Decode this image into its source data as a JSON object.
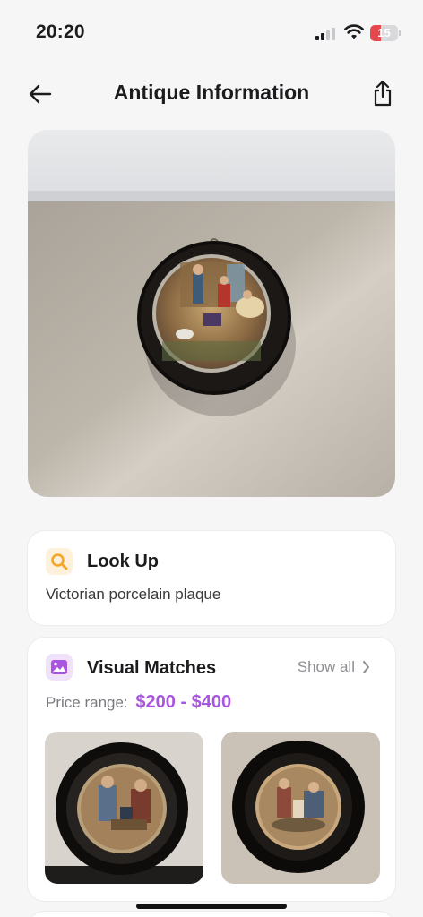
{
  "status_bar": {
    "time": "20:20",
    "battery_level": "15",
    "battery_color": "#e5484d"
  },
  "nav": {
    "title": "Antique Information",
    "back_icon": "arrow-left-icon",
    "share_icon": "share-icon"
  },
  "hero": {
    "image": "photo-porcelain-plaque"
  },
  "lookup": {
    "title": "Look Up",
    "icon": "search-icon",
    "icon_color": "#f5a623",
    "result": "Victorian porcelain plaque"
  },
  "visual_matches": {
    "title": "Visual Matches",
    "icon": "image-icon",
    "icon_color": "#a855e0",
    "show_all_label": "Show all",
    "price_label": "Price range:",
    "price_value": "$200 - $400",
    "price_color": "#a855e0",
    "items": [
      {
        "image": "match-photo-1"
      },
      {
        "image": "match-photo-2"
      }
    ]
  }
}
